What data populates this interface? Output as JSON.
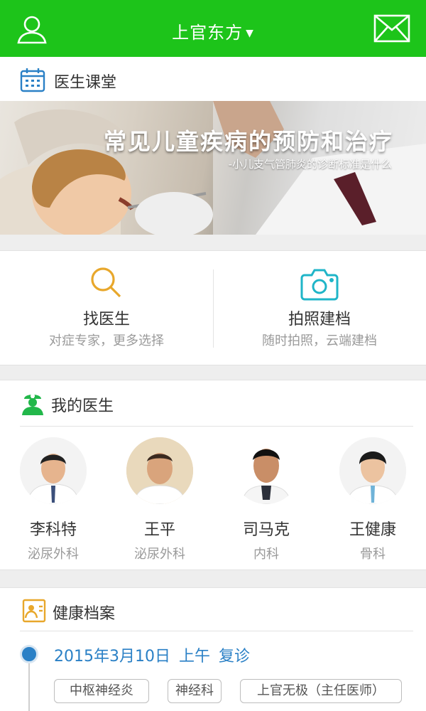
{
  "header": {
    "city": "上官东方",
    "user_icon": "user-icon",
    "mail_icon": "mail-icon"
  },
  "course": {
    "title": "医生课堂",
    "icon": "calendar-icon",
    "banner_title": "常见儿童疾病的预防和治疗",
    "banner_subtitle": "-小儿支气管肺炎的诊断标准是什么"
  },
  "actions": [
    {
      "label": "找医生",
      "desc": "对症专家，更多选择",
      "icon": "search-icon",
      "color": "#e8a72b"
    },
    {
      "label": "拍照建档",
      "desc": "随时拍照，云端建档",
      "icon": "camera-icon",
      "color": "#1fb5c8"
    }
  ],
  "my_doctors": {
    "title": "我的医生",
    "icon": "nurse-icon",
    "doctors": [
      {
        "name": "李科特",
        "dept": "泌尿外科"
      },
      {
        "name": "王平",
        "dept": "泌尿外科"
      },
      {
        "name": "司马克",
        "dept": "内科"
      },
      {
        "name": "王健康",
        "dept": "骨科"
      }
    ]
  },
  "records": {
    "title": "健康档案",
    "icon": "profile-card-icon",
    "entry": {
      "date": "2015年3月10日",
      "period": "上午",
      "type": "复诊"
    },
    "tags": [
      "中枢神经炎",
      "神经科",
      "上官无极（主任医师）"
    ]
  },
  "colors": {
    "brand": "#1dc41a",
    "accent_blue": "#2a80c6"
  }
}
